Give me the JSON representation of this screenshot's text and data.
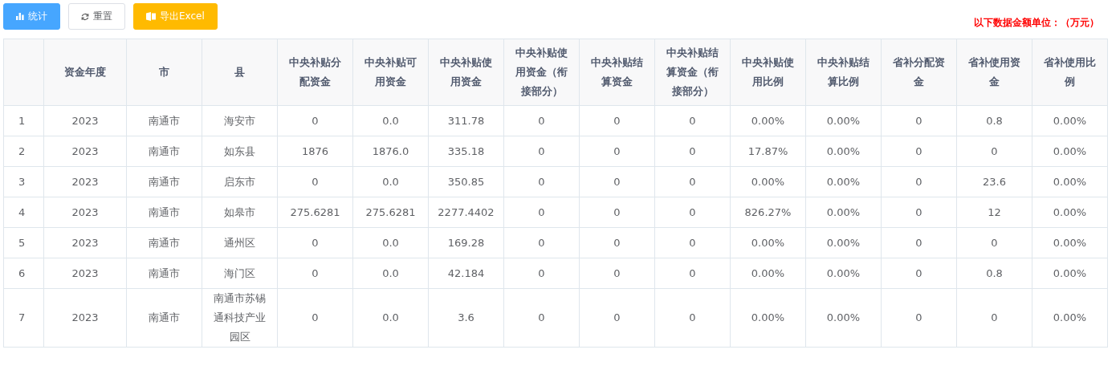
{
  "toolbar": {
    "buttons": [
      {
        "kind": "chart",
        "label": "统计"
      },
      {
        "kind": "reset",
        "label": "重置"
      },
      {
        "kind": "export",
        "label": "导出Excel"
      }
    ]
  },
  "unit_note": "以下数据金额单位：（万元）",
  "table": {
    "columns": [
      "",
      "资金年度",
      "市",
      "县",
      "中央补贴分配资金",
      "中央补贴可用资金",
      "中央补贴使用资金",
      "中央补贴使用资金（衔接部分）",
      "中央补贴结算资金",
      "中央补贴结算资金（衔接部分）",
      "中央补贴使用比例",
      "中央补贴结算比例",
      "省补分配资金",
      "省补使用资金",
      "省补使用比例"
    ],
    "rows": [
      [
        "1",
        "2023",
        "南通市",
        "海安市",
        "0",
        "0.0",
        "311.78",
        "0",
        "0",
        "0",
        "0.00%",
        "0.00%",
        "0",
        "0.8",
        "0.00%"
      ],
      [
        "2",
        "2023",
        "南通市",
        "如东县",
        "1876",
        "1876.0",
        "335.18",
        "0",
        "0",
        "0",
        "17.87%",
        "0.00%",
        "0",
        "0",
        "0.00%"
      ],
      [
        "3",
        "2023",
        "南通市",
        "启东市",
        "0",
        "0.0",
        "350.85",
        "0",
        "0",
        "0",
        "0.00%",
        "0.00%",
        "0",
        "23.6",
        "0.00%"
      ],
      [
        "4",
        "2023",
        "南通市",
        "如皋市",
        "275.6281",
        "275.6281",
        "2277.4402",
        "0",
        "0",
        "0",
        "826.27%",
        "0.00%",
        "0",
        "12",
        "0.00%"
      ],
      [
        "5",
        "2023",
        "南通市",
        "通州区",
        "0",
        "0.0",
        "169.28",
        "0",
        "0",
        "0",
        "0.00%",
        "0.00%",
        "0",
        "0",
        "0.00%"
      ],
      [
        "6",
        "2023",
        "南通市",
        "海门区",
        "0",
        "0.0",
        "42.184",
        "0",
        "0",
        "0",
        "0.00%",
        "0.00%",
        "0",
        "0.8",
        "0.00%"
      ],
      [
        "7",
        "2023",
        "南通市",
        "南通市苏锡通科技产业园区",
        "0",
        "0.0",
        "3.6",
        "0",
        "0",
        "0",
        "0.00%",
        "0.00%",
        "0",
        "0",
        "0.00%"
      ]
    ]
  }
}
